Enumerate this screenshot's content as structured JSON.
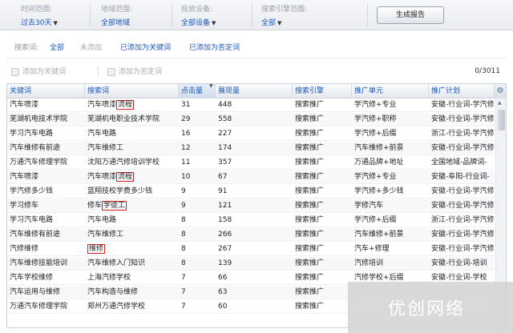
{
  "filters": [
    {
      "label": "时间范围:",
      "value": "过去30天"
    },
    {
      "label": "地域范围:",
      "value": "全部地域"
    },
    {
      "label": "投放设备:",
      "value": "全部设备"
    },
    {
      "label": "搜索引擎范围:",
      "value": "全部"
    }
  ],
  "generate_button": "生成报告",
  "tabs": {
    "label": "搜索词:",
    "items": [
      "全部",
      "未添加",
      "已添加为关键词",
      "已添加为否定词"
    ]
  },
  "toolbar": {
    "add_keyword": "添加为关键词",
    "add_negative": "添加为否定词",
    "count": "0/3011"
  },
  "columns": [
    "关键词",
    "搜索词",
    "点击量",
    "展现量",
    "搜索引擎",
    "推广单元",
    "推广计划"
  ],
  "rows": [
    [
      "汽车喷漆",
      "汽车喷漆",
      "流程",
      "31",
      "448",
      "搜索推广",
      "学汽修+专业",
      "安徽-行业词-学汽修"
    ],
    [
      "芜湖机电技术学院",
      "芜湖机电职业技术学院",
      "",
      "29",
      "558",
      "搜索推广",
      "学汽修+职称",
      "安徽-行业词-学汽修"
    ],
    [
      "学习汽车电路",
      "汽车电路",
      "",
      "16",
      "227",
      "搜索推广",
      "学汽修+后缀",
      "浙江-行业词-学汽修"
    ],
    [
      "汽车维修有前途",
      "汽车维修工",
      "",
      "12",
      "174",
      "搜索推广",
      "汽车维修+前景",
      "安徽-行业词-学汽修"
    ],
    [
      "万通汽车修理学院",
      "沈阳万通汽修培训学校",
      "",
      "11",
      "357",
      "搜索推广",
      "万通品牌+地址",
      "全国地域-品牌词-"
    ],
    [
      "汽车喷漆",
      "汽车喷漆",
      "流程",
      "10",
      "67",
      "搜索推广",
      "学汽修+专业",
      "安徽-阜阳-行业词-"
    ],
    [
      "学汽修多少钱",
      "蓝翔技校学费多少钱",
      "",
      "9",
      "91",
      "搜索推广",
      "学汽修+多少钱",
      "安徽-行业词-学汽修"
    ],
    [
      "学习修车",
      "修车",
      "学徒工",
      "9",
      "121",
      "搜索推广",
      "学修汽车",
      "安徽-行业词-学汽修"
    ],
    [
      "学习汽车电路",
      "汽车电路",
      "",
      "8",
      "158",
      "搜索推广",
      "学汽修+后缀",
      "浙江-行业词-学汽修"
    ],
    [
      "汽车维修有前途",
      "汽车维修工",
      "",
      "8",
      "266",
      "搜索推广",
      "汽车维修+前景",
      "安徽-行业词-学汽修"
    ],
    [
      "汽修维修",
      "",
      "维修",
      "8",
      "267",
      "搜索推广",
      "汽车+修理",
      "安徽-行业词-学汽修"
    ],
    [
      "汽车维修技能培训",
      "汽车维修入门知识",
      "",
      "8",
      "139",
      "搜索推广",
      "汽修培训",
      "安徽-行业词-培训"
    ],
    [
      "汽车学校维修",
      "上海汽修学校",
      "",
      "7",
      "66",
      "搜索推广",
      "汽修学校+后缀",
      "安徽-行业词-学校"
    ],
    [
      "汽车运用与维修",
      "汽车构造与维修",
      "",
      "7",
      "63",
      "搜索推广",
      "",
      ""
    ],
    [
      "万通汽车修理学院",
      "郑州万通汽修学校",
      "",
      "7",
      "60",
      "搜索推广",
      "",
      ""
    ]
  ],
  "watermark": "优创网络"
}
